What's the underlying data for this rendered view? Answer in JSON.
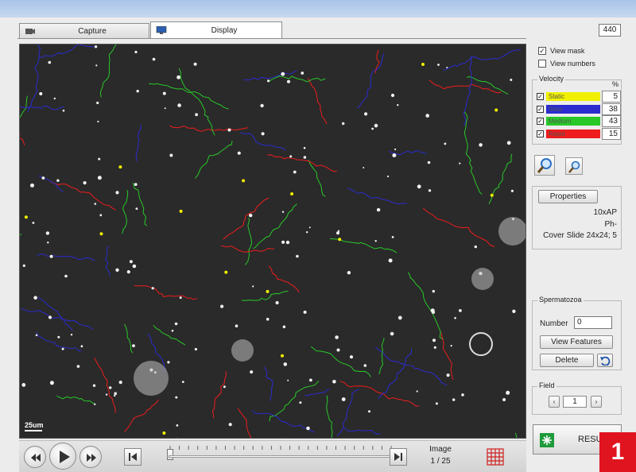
{
  "tabs": [
    {
      "label": "Capture",
      "icon": "camera-icon",
      "active": false
    },
    {
      "label": "Display",
      "icon": "monitor-icon",
      "active": true
    }
  ],
  "frame_counter": "440",
  "display_options": {
    "view_mask": {
      "label": "View mask",
      "checked": true
    },
    "view_numbers": {
      "label": "View numbers",
      "checked": false
    }
  },
  "velocity": {
    "title": "Velocity",
    "percent_header": "%",
    "classes": [
      {
        "label": "Static",
        "value": "5",
        "color": "#f0f000"
      },
      {
        "label": "Slow",
        "value": "38",
        "color": "#2b2bd0"
      },
      {
        "label": "Medium",
        "value": "43",
        "color": "#28c828"
      },
      {
        "label": "Rapid",
        "value": "15",
        "color": "#ee1c1c"
      }
    ]
  },
  "zoom": {
    "zoom_in_icon": "zoom-in-icon",
    "zoom_out_icon": "zoom-out-icon"
  },
  "properties": {
    "button": "Properties",
    "lines": [
      "10xAP",
      "Ph-",
      "Cover Slide 24x24; 5"
    ]
  },
  "spermatozoa": {
    "title": "Spermatozoa",
    "number_label": "Number",
    "number_value": "0",
    "view_features": "View Features",
    "delete": "Delete"
  },
  "field": {
    "title": "Field",
    "value": "1"
  },
  "image": {
    "label": "Image",
    "position": "1  /  25",
    "current": 1,
    "total": 25
  },
  "scale_bar": "25um",
  "results_button": "RESULTS",
  "badge": "1"
}
